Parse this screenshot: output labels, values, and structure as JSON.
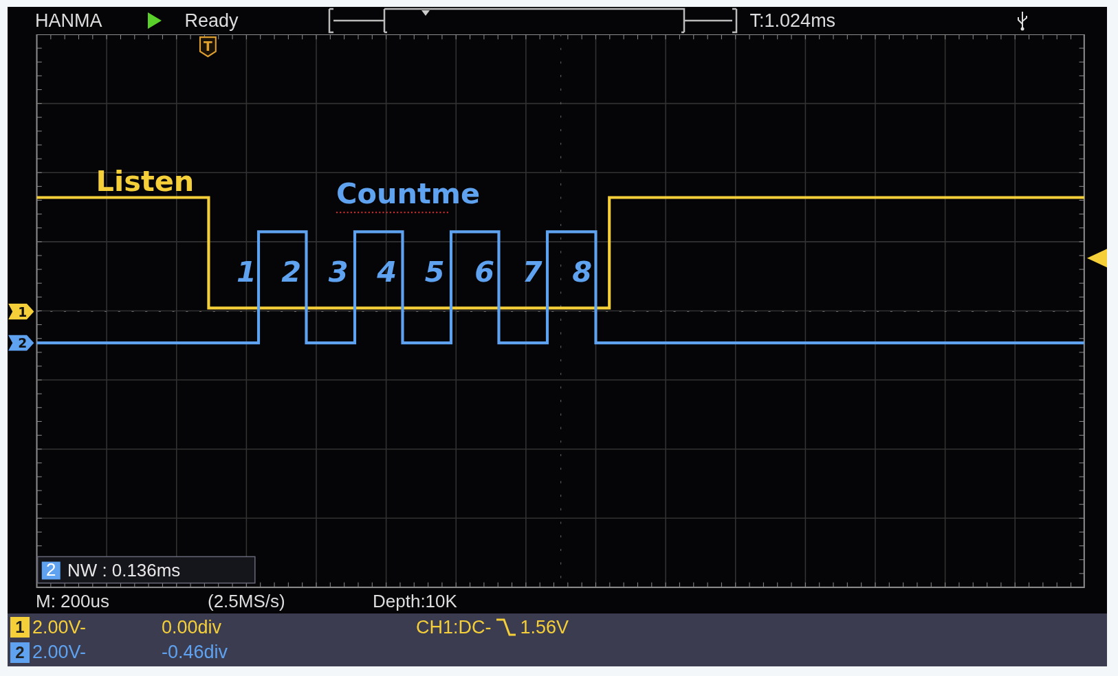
{
  "top_bar": {
    "brand": "HANMA",
    "status": "Ready",
    "trigger_time": "T:1.024ms"
  },
  "plot": {
    "annotations": [
      {
        "text": "Listen",
        "kind": "ch1"
      },
      {
        "text": "Countme",
        "kind": "ch2"
      }
    ],
    "pulse_numbers": [
      "1",
      "2",
      "3",
      "4",
      "5",
      "6",
      "7",
      "8"
    ],
    "trigger_marker": "T",
    "measurement": {
      "channel": "2",
      "text": "NW : 0.136ms"
    }
  },
  "info_line": {
    "timebase": "M: 200us",
    "sample_rate": "(2.5MS/s)",
    "depth": "Depth:10K"
  },
  "channels": [
    {
      "marker": "1",
      "number": "1",
      "color": "#f5cf3a",
      "scale": "2.00V-",
      "offset": "0.00div"
    },
    {
      "marker": "2",
      "number": "2",
      "color": "#5ea2f0",
      "scale": "2.00V-",
      "offset": "-0.46div"
    }
  ],
  "trigger": {
    "source": "CH1:DC-",
    "level": "1.56V"
  }
}
